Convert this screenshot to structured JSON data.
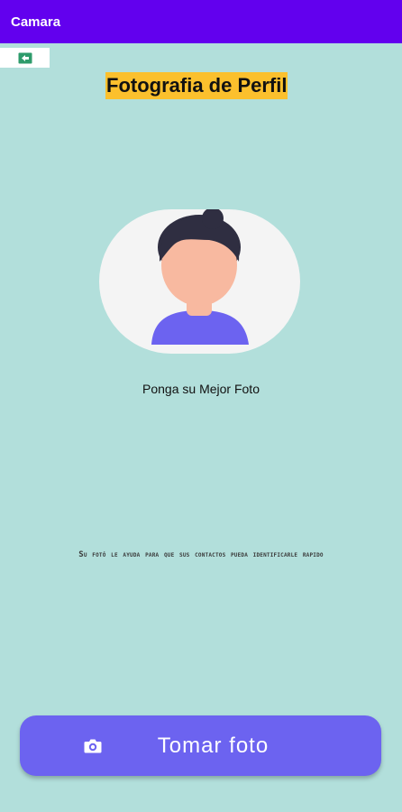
{
  "app_bar": {
    "title": "Camara"
  },
  "page": {
    "title": "Fotografia de Perfil",
    "photo_caption": "Ponga su Mejor Foto",
    "info_text": "Su fotó le ayuda para que sus contactos pueda identificarle rapido"
  },
  "actions": {
    "take_photo_label": "Tomar foto"
  },
  "icons": {
    "back": "exit-arrow-icon",
    "camera": "camera-rotate-icon",
    "avatar": "person-avatar-icon"
  },
  "colors": {
    "app_bar": "#6200ee",
    "background": "#b2dfdb",
    "title_highlight": "#fbc02d",
    "button": "#6c63f0",
    "avatar_shirt": "#6c63f0",
    "back_icon": "#2e9b6b"
  }
}
